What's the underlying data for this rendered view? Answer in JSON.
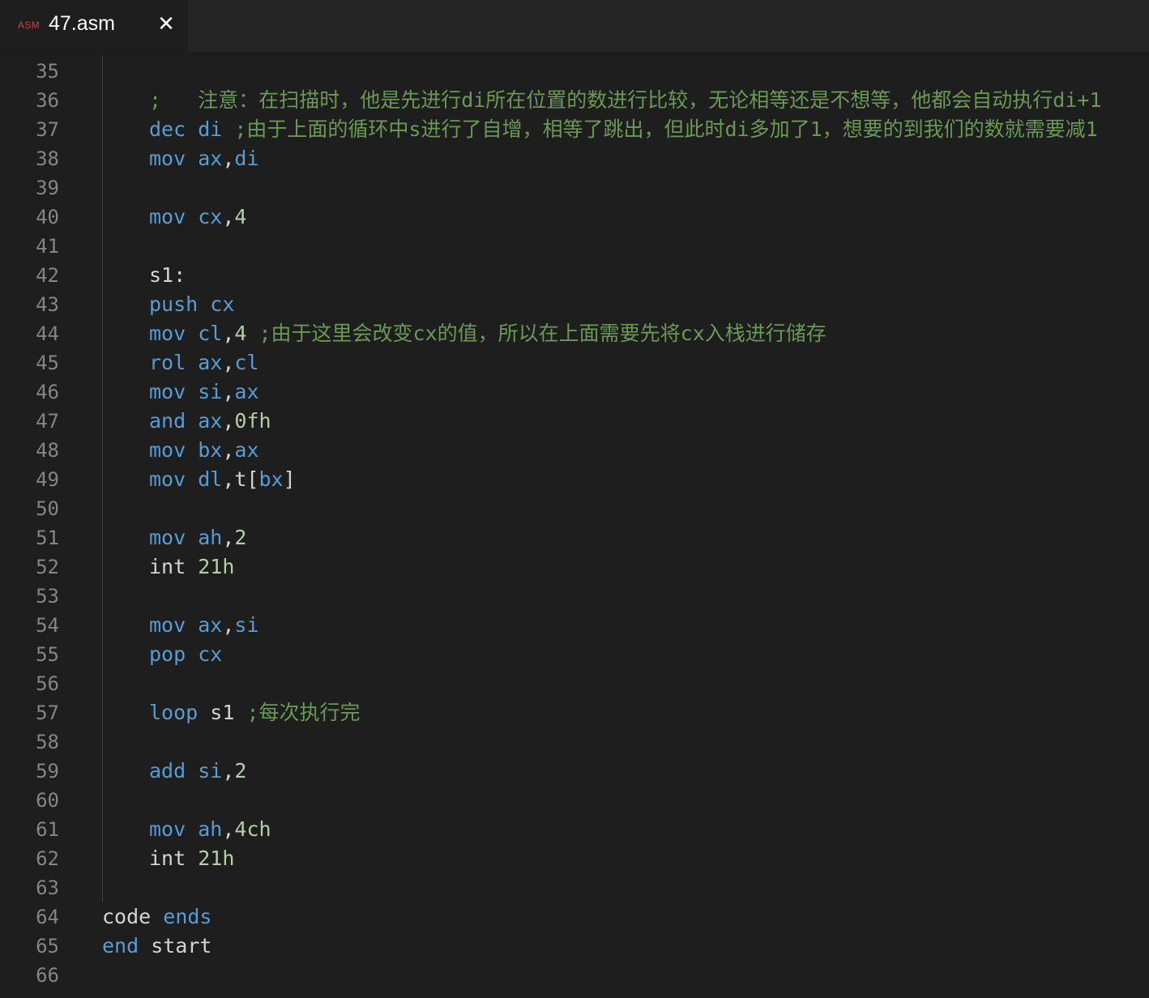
{
  "tab": {
    "language_badge": "ASM",
    "title": "47.asm",
    "close_glyph": "✕",
    "icon": "asm-file-icon"
  },
  "colors": {
    "background": "#1e1e1e",
    "keyword": "#569cd6",
    "number": "#b5cea8",
    "comment": "#6a9955",
    "text": "#d4d4d4",
    "line_number": "#858585"
  },
  "lines": [
    {
      "n": "35",
      "indent": 0,
      "tokens": []
    },
    {
      "n": "36",
      "indent": 1,
      "tokens": [
        {
          "t": ";   注意：在扫描时，他是先进行di所在位置的数进行比较，无论相等还是不想等，他都会自动执行di+1",
          "c": "cmt"
        }
      ]
    },
    {
      "n": "37",
      "indent": 1,
      "tokens": [
        {
          "t": "dec",
          "c": "kw"
        },
        {
          "t": " ",
          "c": "txt"
        },
        {
          "t": "di",
          "c": "reg"
        },
        {
          "t": " ;由于上面的循环中s进行了自增，相等了跳出，但此时di多加了1，想要的到我们的数就需要减1",
          "c": "cmt"
        }
      ]
    },
    {
      "n": "38",
      "indent": 1,
      "tokens": [
        {
          "t": "mov",
          "c": "kw"
        },
        {
          "t": " ",
          "c": "txt"
        },
        {
          "t": "ax",
          "c": "reg"
        },
        {
          "t": ",",
          "c": "txt"
        },
        {
          "t": "di",
          "c": "reg"
        }
      ]
    },
    {
      "n": "39",
      "indent": 0,
      "tokens": []
    },
    {
      "n": "40",
      "indent": 1,
      "tokens": [
        {
          "t": "mov",
          "c": "kw"
        },
        {
          "t": " ",
          "c": "txt"
        },
        {
          "t": "cx",
          "c": "reg"
        },
        {
          "t": ",",
          "c": "txt"
        },
        {
          "t": "4",
          "c": "num"
        }
      ]
    },
    {
      "n": "41",
      "indent": 0,
      "tokens": []
    },
    {
      "n": "42",
      "indent": 1,
      "tokens": [
        {
          "t": "s1:",
          "c": "txt"
        }
      ]
    },
    {
      "n": "43",
      "indent": 1,
      "tokens": [
        {
          "t": "push",
          "c": "kw"
        },
        {
          "t": " ",
          "c": "txt"
        },
        {
          "t": "cx",
          "c": "reg"
        }
      ]
    },
    {
      "n": "44",
      "indent": 1,
      "tokens": [
        {
          "t": "mov",
          "c": "kw"
        },
        {
          "t": " ",
          "c": "txt"
        },
        {
          "t": "cl",
          "c": "reg"
        },
        {
          "t": ",",
          "c": "txt"
        },
        {
          "t": "4",
          "c": "num"
        },
        {
          "t": " ;由于这里会改变cx的值，所以在上面需要先将cx入栈进行储存",
          "c": "cmt"
        }
      ]
    },
    {
      "n": "45",
      "indent": 1,
      "tokens": [
        {
          "t": "rol",
          "c": "kw"
        },
        {
          "t": " ",
          "c": "txt"
        },
        {
          "t": "ax",
          "c": "reg"
        },
        {
          "t": ",",
          "c": "txt"
        },
        {
          "t": "cl",
          "c": "reg"
        }
      ]
    },
    {
      "n": "46",
      "indent": 1,
      "tokens": [
        {
          "t": "mov",
          "c": "kw"
        },
        {
          "t": " ",
          "c": "txt"
        },
        {
          "t": "si",
          "c": "reg"
        },
        {
          "t": ",",
          "c": "txt"
        },
        {
          "t": "ax",
          "c": "reg"
        }
      ]
    },
    {
      "n": "47",
      "indent": 1,
      "tokens": [
        {
          "t": "and",
          "c": "kw"
        },
        {
          "t": " ",
          "c": "txt"
        },
        {
          "t": "ax",
          "c": "reg"
        },
        {
          "t": ",",
          "c": "txt"
        },
        {
          "t": "0fh",
          "c": "num"
        }
      ]
    },
    {
      "n": "48",
      "indent": 1,
      "tokens": [
        {
          "t": "mov",
          "c": "kw"
        },
        {
          "t": " ",
          "c": "txt"
        },
        {
          "t": "bx",
          "c": "reg"
        },
        {
          "t": ",",
          "c": "txt"
        },
        {
          "t": "ax",
          "c": "reg"
        }
      ]
    },
    {
      "n": "49",
      "indent": 1,
      "tokens": [
        {
          "t": "mov",
          "c": "kw"
        },
        {
          "t": " ",
          "c": "txt"
        },
        {
          "t": "dl",
          "c": "reg"
        },
        {
          "t": ",t[",
          "c": "txt"
        },
        {
          "t": "bx",
          "c": "reg"
        },
        {
          "t": "]",
          "c": "txt"
        }
      ]
    },
    {
      "n": "50",
      "indent": 0,
      "tokens": []
    },
    {
      "n": "51",
      "indent": 1,
      "tokens": [
        {
          "t": "mov",
          "c": "kw"
        },
        {
          "t": " ",
          "c": "txt"
        },
        {
          "t": "ah",
          "c": "reg"
        },
        {
          "t": ",",
          "c": "txt"
        },
        {
          "t": "2",
          "c": "num"
        }
      ]
    },
    {
      "n": "52",
      "indent": 1,
      "tokens": [
        {
          "t": "int",
          "c": "txt"
        },
        {
          "t": " ",
          "c": "txt"
        },
        {
          "t": "21h",
          "c": "num"
        }
      ]
    },
    {
      "n": "53",
      "indent": 0,
      "tokens": []
    },
    {
      "n": "54",
      "indent": 1,
      "tokens": [
        {
          "t": "mov",
          "c": "kw"
        },
        {
          "t": " ",
          "c": "txt"
        },
        {
          "t": "ax",
          "c": "reg"
        },
        {
          "t": ",",
          "c": "txt"
        },
        {
          "t": "si",
          "c": "reg"
        }
      ]
    },
    {
      "n": "55",
      "indent": 1,
      "tokens": [
        {
          "t": "pop",
          "c": "kw"
        },
        {
          "t": " ",
          "c": "txt"
        },
        {
          "t": "cx",
          "c": "reg"
        }
      ]
    },
    {
      "n": "56",
      "indent": 0,
      "tokens": []
    },
    {
      "n": "57",
      "indent": 1,
      "tokens": [
        {
          "t": "loop",
          "c": "kw"
        },
        {
          "t": " s1 ",
          "c": "txt"
        },
        {
          "t": ";每次执行完",
          "c": "cmt"
        }
      ]
    },
    {
      "n": "58",
      "indent": 0,
      "tokens": []
    },
    {
      "n": "59",
      "indent": 1,
      "tokens": [
        {
          "t": "add",
          "c": "kw"
        },
        {
          "t": " ",
          "c": "txt"
        },
        {
          "t": "si",
          "c": "reg"
        },
        {
          "t": ",",
          "c": "txt"
        },
        {
          "t": "2",
          "c": "num"
        }
      ]
    },
    {
      "n": "60",
      "indent": 0,
      "tokens": []
    },
    {
      "n": "61",
      "indent": 1,
      "tokens": [
        {
          "t": "mov",
          "c": "kw"
        },
        {
          "t": " ",
          "c": "txt"
        },
        {
          "t": "ah",
          "c": "reg"
        },
        {
          "t": ",",
          "c": "txt"
        },
        {
          "t": "4ch",
          "c": "num"
        }
      ]
    },
    {
      "n": "62",
      "indent": 1,
      "tokens": [
        {
          "t": "int",
          "c": "txt"
        },
        {
          "t": " ",
          "c": "txt"
        },
        {
          "t": "21h",
          "c": "num"
        }
      ]
    },
    {
      "n": "63",
      "indent": 0,
      "tokens": []
    },
    {
      "n": "64",
      "indent": 0,
      "tokens": [
        {
          "t": "code",
          "c": "txt"
        },
        {
          "t": " ",
          "c": "txt"
        },
        {
          "t": "ends",
          "c": "kw"
        }
      ]
    },
    {
      "n": "65",
      "indent": 0,
      "tokens": [
        {
          "t": "end",
          "c": "kw"
        },
        {
          "t": " start",
          "c": "txt"
        }
      ]
    },
    {
      "n": "66",
      "indent": 0,
      "tokens": []
    }
  ]
}
